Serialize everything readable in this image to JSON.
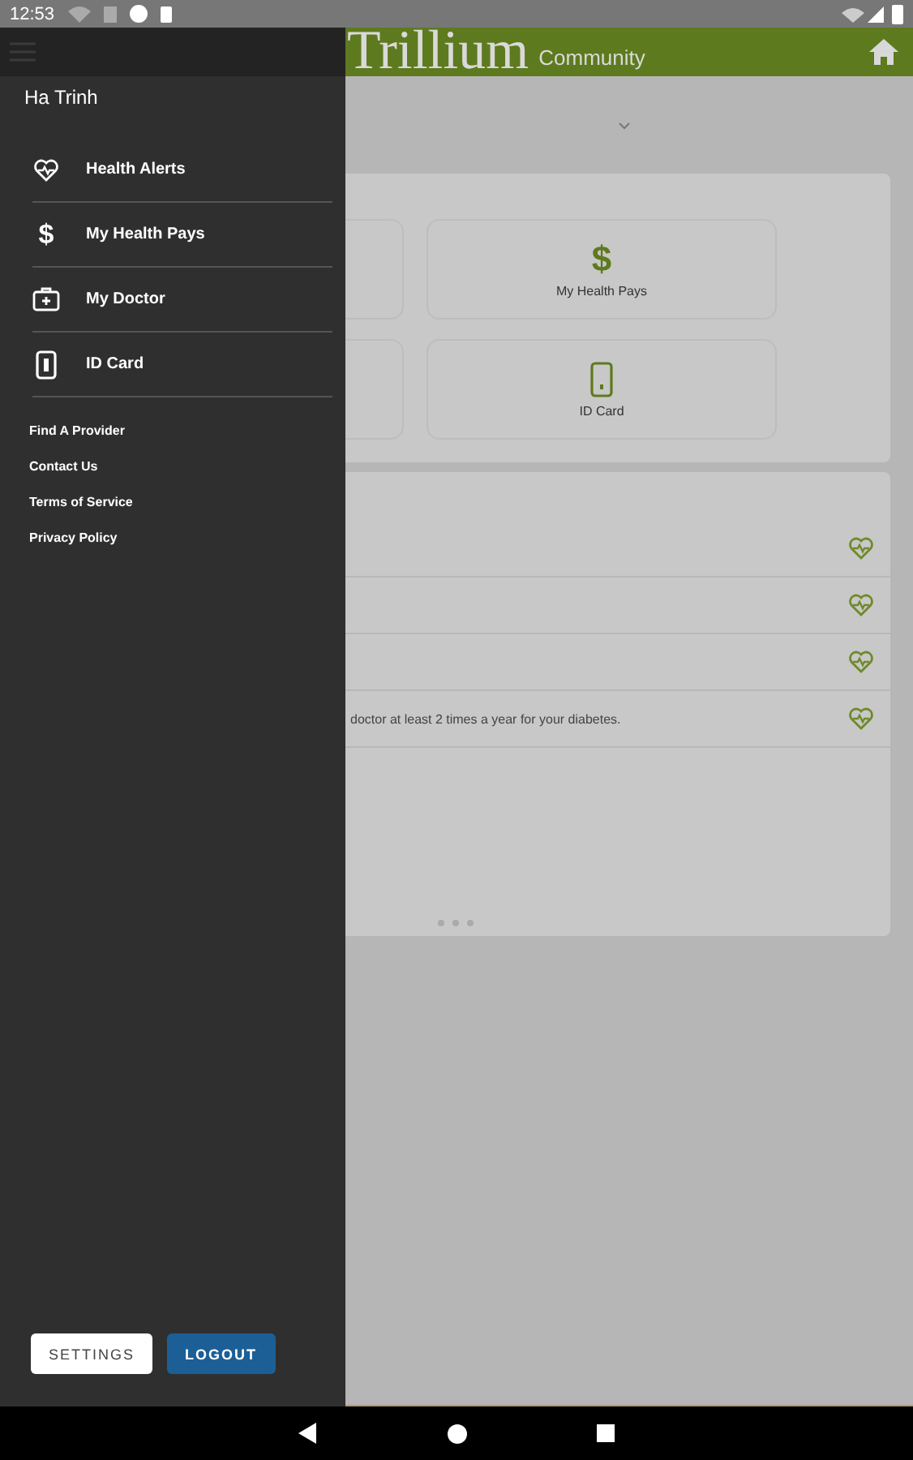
{
  "status_bar": {
    "time": "12:53"
  },
  "header": {
    "logo": "Trillium",
    "logo_sub": "Community"
  },
  "tiles": [
    {
      "kind": "covered"
    },
    {
      "kind": "glyph",
      "glyph": "$",
      "label": "My Health Pays"
    },
    {
      "kind": "covered"
    },
    {
      "kind": "phone",
      "label": "ID Card"
    }
  ],
  "alerts": [
    {
      "kind": "covered"
    },
    {
      "kind": "covered"
    },
    {
      "kind": "covered"
    },
    {
      "kind": "text",
      "text": "doctor at least 2 times a year for your diabetes."
    }
  ],
  "drawer": {
    "user": "Ha Trinh",
    "items": [
      {
        "label": "Health Alerts",
        "kind": "heart"
      },
      {
        "label": "My Health Pays",
        "kind": "glyph",
        "glyph": "$"
      },
      {
        "label": "My Doctor",
        "kind": "bag"
      },
      {
        "label": "ID Card",
        "kind": "phone"
      }
    ],
    "links": [
      "Find A Provider",
      "Contact Us",
      "Terms of Service",
      "Privacy Policy"
    ],
    "buttons": [
      {
        "label": "SETTINGS",
        "kind": "secondary"
      },
      {
        "label": "LOGOUT",
        "kind": "primary"
      }
    ]
  }
}
